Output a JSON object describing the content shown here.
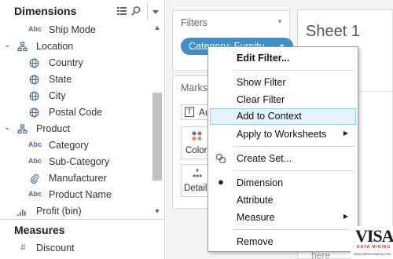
{
  "data_pane": {
    "title": "Dimensions",
    "fields": [
      {
        "type": "Abc",
        "name": "Ship Mode"
      },
      {
        "type": "folder",
        "name": "Location"
      },
      {
        "type": "globe",
        "name": "Country"
      },
      {
        "type": "globe",
        "name": "State"
      },
      {
        "type": "globe",
        "name": "City"
      },
      {
        "type": "globe",
        "name": "Postal Code"
      },
      {
        "type": "folder",
        "name": "Product"
      },
      {
        "type": "Abc",
        "name": "Category"
      },
      {
        "type": "Abc",
        "name": "Sub-Category"
      },
      {
        "type": "clip",
        "name": "Manufacturer"
      },
      {
        "type": "Abc",
        "name": "Product Name"
      },
      {
        "type": "bins",
        "name": "Profit (bin)"
      }
    ],
    "measures_title": "Measures",
    "measures": [
      {
        "type": "#",
        "name": "Discount"
      }
    ]
  },
  "filters_card": {
    "title": "Filters",
    "pill_label": "Category: Furnitu..."
  },
  "marks_card": {
    "title": "Marks",
    "mark_type": "Au",
    "color_label": "Color",
    "detail_label": "Detail"
  },
  "sheet": {
    "title": "Sheet 1",
    "drop_hint": "here"
  },
  "context_menu": {
    "items": [
      {
        "label": "Edit Filter...",
        "bold": true
      },
      {
        "label": "Show Filter"
      },
      {
        "label": "Clear Filter"
      },
      {
        "label": "Add to Context",
        "highlighted": true
      },
      {
        "label": "Apply to Worksheets",
        "submenu": true
      },
      {
        "label": "Create Set..."
      },
      {
        "label": "Dimension",
        "checked": true
      },
      {
        "label": "Attribute"
      },
      {
        "label": "Measure",
        "submenu": true
      },
      {
        "label": "Remove"
      }
    ]
  },
  "watermark": {
    "logo": "VISA",
    "tagline": "DATA MINING",
    "url": "www.vistacompany.com"
  },
  "colors": {
    "pill": "#3f8fc9",
    "highlight": "#e5f1fb",
    "type_blue": "#4a6d96"
  }
}
